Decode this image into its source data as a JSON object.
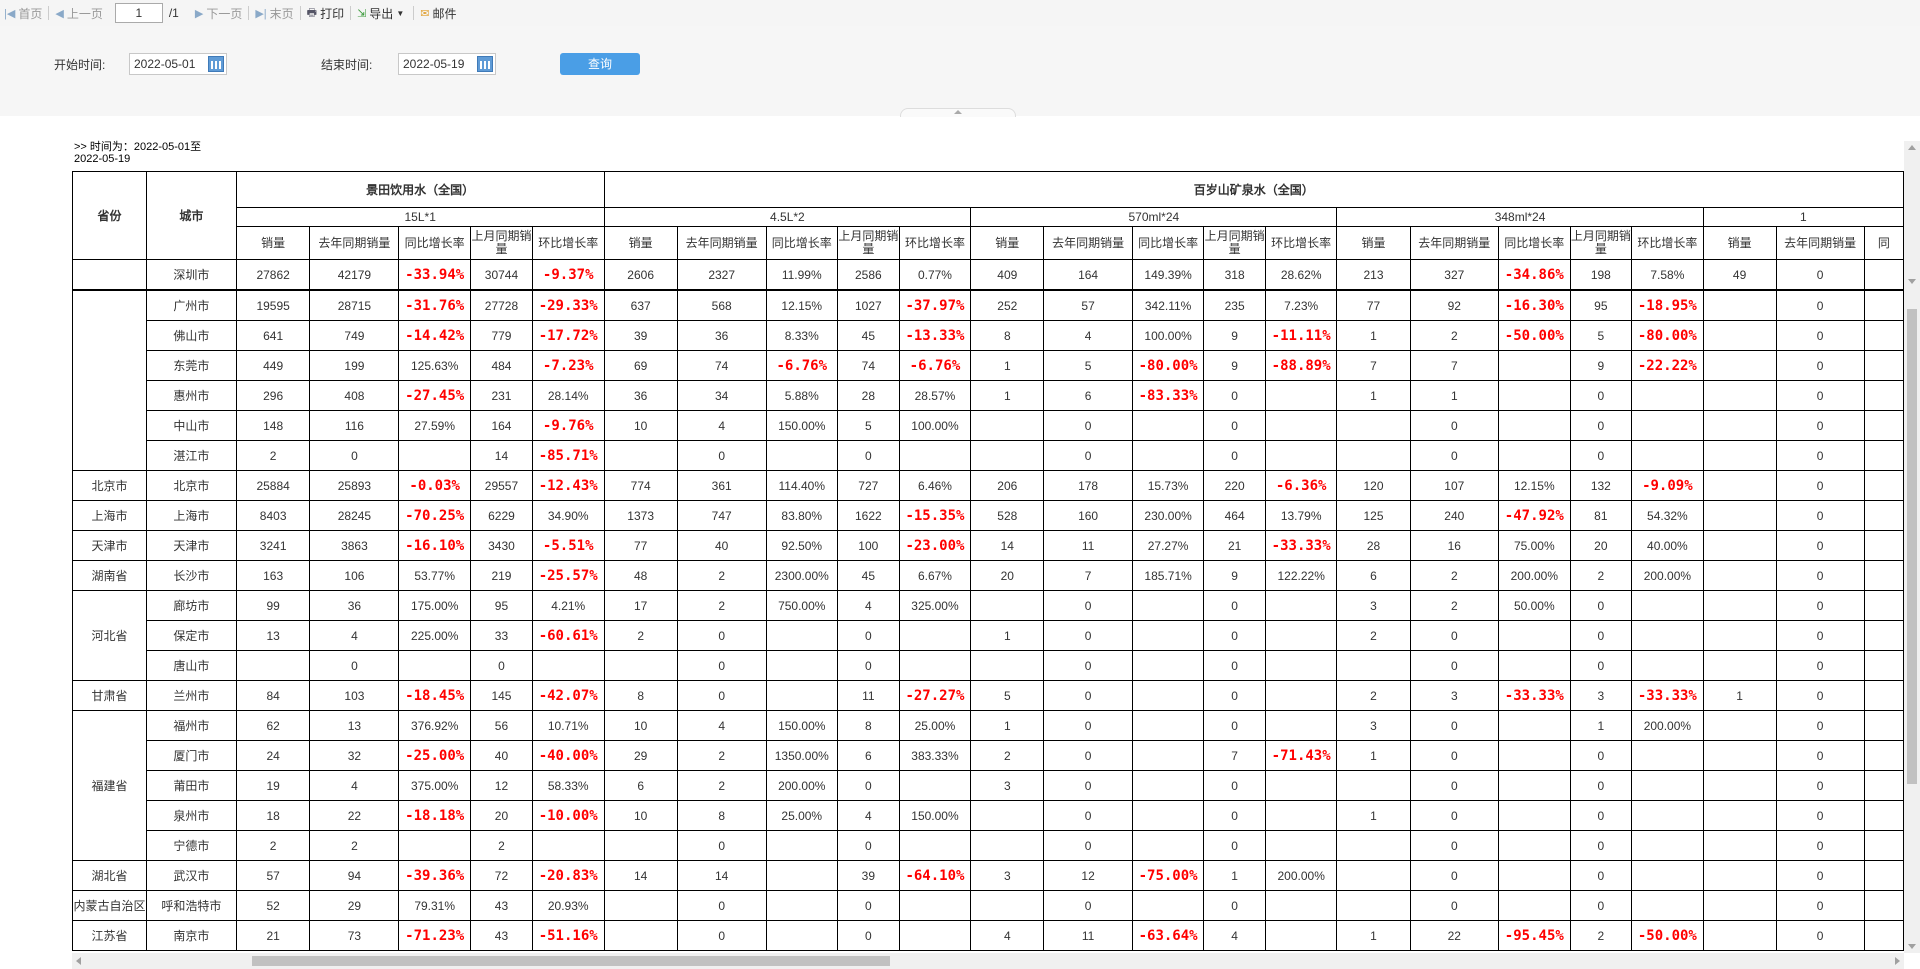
{
  "toolbar": {
    "first": "首页",
    "prev": "上一页",
    "page": "1",
    "total": "/1",
    "next": "下一页",
    "last": "末页",
    "print": "打印",
    "export": "导出",
    "mail": "邮件"
  },
  "filter": {
    "start_label": "开始时间:",
    "start_value": "2022-05-01",
    "end_label": "结束时间:",
    "end_value": "2022-05-19",
    "query": "查询"
  },
  "report": {
    "time_line1": ">> 时间为：2022-05-01至",
    "time_line2": "2022-05-19",
    "col_province": "省份",
    "col_city": "城市",
    "brand1": "景田饮用水（全国）",
    "brand2": "百岁山矿泉水（全国）",
    "spec1": "15L*1",
    "spec2": "4.5L*2",
    "spec3": "570ml*24",
    "spec4": "348ml*24",
    "spec5": "1",
    "metrics": [
      "销量",
      "去年同期销量",
      "同比增长率",
      "上月同期销量",
      "环比增长率"
    ],
    "metrics_last": [
      "销量",
      "去年同期销量",
      "同"
    ],
    "groups": [
      {
        "province": "",
        "rows": [
          {
            "city": "深圳市",
            "v": [
              "27862",
              "42179",
              "-33.94%",
              "30744",
              "-9.37%",
              "2606",
              "2327",
              "11.99%",
              "2586",
              "0.77%",
              "409",
              "164",
              "149.39%",
              "318",
              "28.62%",
              "213",
              "327",
              "-34.86%",
              "198",
              "7.58%",
              "49",
              "0",
              ""
            ]
          }
        ]
      },
      {
        "province": "",
        "rows": [
          {
            "city": "广州市",
            "v": [
              "19595",
              "28715",
              "-31.76%",
              "27728",
              "-29.33%",
              "637",
              "568",
              "12.15%",
              "1027",
              "-37.97%",
              "252",
              "57",
              "342.11%",
              "235",
              "7.23%",
              "77",
              "92",
              "-16.30%",
              "95",
              "-18.95%",
              "",
              "0",
              ""
            ]
          },
          {
            "city": "佛山市",
            "v": [
              "641",
              "749",
              "-14.42%",
              "779",
              "-17.72%",
              "39",
              "36",
              "8.33%",
              "45",
              "-13.33%",
              "8",
              "4",
              "100.00%",
              "9",
              "-11.11%",
              "1",
              "2",
              "-50.00%",
              "5",
              "-80.00%",
              "",
              "0",
              ""
            ]
          },
          {
            "city": "东莞市",
            "v": [
              "449",
              "199",
              "125.63%",
              "484",
              "-7.23%",
              "69",
              "74",
              "-6.76%",
              "74",
              "-6.76%",
              "1",
              "5",
              "-80.00%",
              "9",
              "-88.89%",
              "7",
              "7",
              "",
              "9",
              "-22.22%",
              "",
              "0",
              ""
            ]
          },
          {
            "city": "惠州市",
            "v": [
              "296",
              "408",
              "-27.45%",
              "231",
              "28.14%",
              "36",
              "34",
              "5.88%",
              "28",
              "28.57%",
              "1",
              "6",
              "-83.33%",
              "0",
              "",
              "1",
              "1",
              "",
              "0",
              "",
              "",
              "0",
              ""
            ]
          },
          {
            "city": "中山市",
            "v": [
              "148",
              "116",
              "27.59%",
              "164",
              "-9.76%",
              "10",
              "4",
              "150.00%",
              "5",
              "100.00%",
              "",
              "0",
              "",
              "0",
              "",
              "",
              "0",
              "",
              "0",
              "",
              "",
              "0",
              ""
            ]
          },
          {
            "city": "湛江市",
            "v": [
              "2",
              "0",
              "",
              "14",
              "-85.71%",
              "",
              "0",
              "",
              "0",
              "",
              "",
              "0",
              "",
              "0",
              "",
              "",
              "0",
              "",
              "0",
              "",
              "",
              "0",
              ""
            ]
          }
        ]
      },
      {
        "province": "北京市",
        "rows": [
          {
            "city": "北京市",
            "v": [
              "25884",
              "25893",
              "-0.03%",
              "29557",
              "-12.43%",
              "774",
              "361",
              "114.40%",
              "727",
              "6.46%",
              "206",
              "178",
              "15.73%",
              "220",
              "-6.36%",
              "120",
              "107",
              "12.15%",
              "132",
              "-9.09%",
              "",
              "0",
              ""
            ]
          }
        ]
      },
      {
        "province": "上海市",
        "rows": [
          {
            "city": "上海市",
            "v": [
              "8403",
              "28245",
              "-70.25%",
              "6229",
              "34.90%",
              "1373",
              "747",
              "83.80%",
              "1622",
              "-15.35%",
              "528",
              "160",
              "230.00%",
              "464",
              "13.79%",
              "125",
              "240",
              "-47.92%",
              "81",
              "54.32%",
              "",
              "0",
              ""
            ]
          }
        ]
      },
      {
        "province": "天津市",
        "rows": [
          {
            "city": "天津市",
            "v": [
              "3241",
              "3863",
              "-16.10%",
              "3430",
              "-5.51%",
              "77",
              "40",
              "92.50%",
              "100",
              "-23.00%",
              "14",
              "11",
              "27.27%",
              "21",
              "-33.33%",
              "28",
              "16",
              "75.00%",
              "20",
              "40.00%",
              "",
              "0",
              ""
            ]
          }
        ]
      },
      {
        "province": "湖南省",
        "rows": [
          {
            "city": "长沙市",
            "v": [
              "163",
              "106",
              "53.77%",
              "219",
              "-25.57%",
              "48",
              "2",
              "2300.00%",
              "45",
              "6.67%",
              "20",
              "7",
              "185.71%",
              "9",
              "122.22%",
              "6",
              "2",
              "200.00%",
              "2",
              "200.00%",
              "",
              "0",
              ""
            ]
          }
        ]
      },
      {
        "province": "河北省",
        "rows": [
          {
            "city": "廊坊市",
            "v": [
              "99",
              "36",
              "175.00%",
              "95",
              "4.21%",
              "17",
              "2",
              "750.00%",
              "4",
              "325.00%",
              "",
              "0",
              "",
              "0",
              "",
              "3",
              "2",
              "50.00%",
              "0",
              "",
              "",
              "0",
              ""
            ]
          },
          {
            "city": "保定市",
            "v": [
              "13",
              "4",
              "225.00%",
              "33",
              "-60.61%",
              "2",
              "0",
              "",
              "0",
              "",
              "1",
              "0",
              "",
              "0",
              "",
              "2",
              "0",
              "",
              "0",
              "",
              "",
              "0",
              ""
            ]
          },
          {
            "city": "唐山市",
            "v": [
              "",
              "0",
              "",
              "0",
              "",
              "",
              "0",
              "",
              "0",
              "",
              "",
              "0",
              "",
              "0",
              "",
              "",
              "0",
              "",
              "0",
              "",
              "",
              "0",
              ""
            ]
          }
        ]
      },
      {
        "province": "甘肃省",
        "rows": [
          {
            "city": "兰州市",
            "v": [
              "84",
              "103",
              "-18.45%",
              "145",
              "-42.07%",
              "8",
              "0",
              "",
              "11",
              "-27.27%",
              "5",
              "0",
              "",
              "0",
              "",
              "2",
              "3",
              "-33.33%",
              "3",
              "-33.33%",
              "1",
              "0",
              ""
            ]
          }
        ]
      },
      {
        "province": "福建省",
        "rows": [
          {
            "city": "福州市",
            "v": [
              "62",
              "13",
              "376.92%",
              "56",
              "10.71%",
              "10",
              "4",
              "150.00%",
              "8",
              "25.00%",
              "1",
              "0",
              "",
              "0",
              "",
              "3",
              "0",
              "",
              "1",
              "200.00%",
              "",
              "0",
              ""
            ]
          },
          {
            "city": "厦门市",
            "v": [
              "24",
              "32",
              "-25.00%",
              "40",
              "-40.00%",
              "29",
              "2",
              "1350.00%",
              "6",
              "383.33%",
              "2",
              "0",
              "",
              "7",
              "-71.43%",
              "1",
              "0",
              "",
              "0",
              "",
              "",
              "0",
              ""
            ]
          },
          {
            "city": "莆田市",
            "v": [
              "19",
              "4",
              "375.00%",
              "12",
              "58.33%",
              "6",
              "2",
              "200.00%",
              "0",
              "",
              "3",
              "0",
              "",
              "0",
              "",
              "",
              "0",
              "",
              "0",
              "",
              "",
              "0",
              ""
            ]
          },
          {
            "city": "泉州市",
            "v": [
              "18",
              "22",
              "-18.18%",
              "20",
              "-10.00%",
              "10",
              "8",
              "25.00%",
              "4",
              "150.00%",
              "",
              "0",
              "",
              "0",
              "",
              "1",
              "0",
              "",
              "0",
              "",
              "",
              "0",
              ""
            ]
          },
          {
            "city": "宁德市",
            "v": [
              "2",
              "2",
              "",
              "2",
              "",
              "",
              "0",
              "",
              "0",
              "",
              "",
              "0",
              "",
              "0",
              "",
              "",
              "0",
              "",
              "0",
              "",
              "",
              "0",
              ""
            ]
          }
        ]
      },
      {
        "province": "湖北省",
        "rows": [
          {
            "city": "武汉市",
            "v": [
              "57",
              "94",
              "-39.36%",
              "72",
              "-20.83%",
              "14",
              "14",
              "",
              "39",
              "-64.10%",
              "3",
              "12",
              "-75.00%",
              "1",
              "200.00%",
              "",
              "0",
              "",
              "0",
              "",
              "",
              "0",
              ""
            ]
          }
        ]
      },
      {
        "province": "内蒙古自治区",
        "rows": [
          {
            "city": "呼和浩特市",
            "v": [
              "52",
              "29",
              "79.31%",
              "43",
              "20.93%",
              "",
              "0",
              "",
              "0",
              "",
              "",
              "0",
              "",
              "0",
              "",
              "",
              "0",
              "",
              "0",
              "",
              "",
              "0",
              ""
            ]
          }
        ]
      },
      {
        "province": "江苏省",
        "rows": [
          {
            "city": "南京市",
            "v": [
              "21",
              "73",
              "-71.23%",
              "43",
              "-51.16%",
              "",
              "0",
              "",
              "0",
              "",
              "4",
              "11",
              "-63.64%",
              "4",
              "",
              "1",
              "22",
              "-95.45%",
              "2",
              "-50.00%",
              "",
              "0",
              ""
            ]
          }
        ]
      }
    ]
  },
  "colors": {
    "negative": "#ff0000",
    "query_button": "#4a9ee6",
    "toolbar_bg": "#f5f5f5"
  }
}
